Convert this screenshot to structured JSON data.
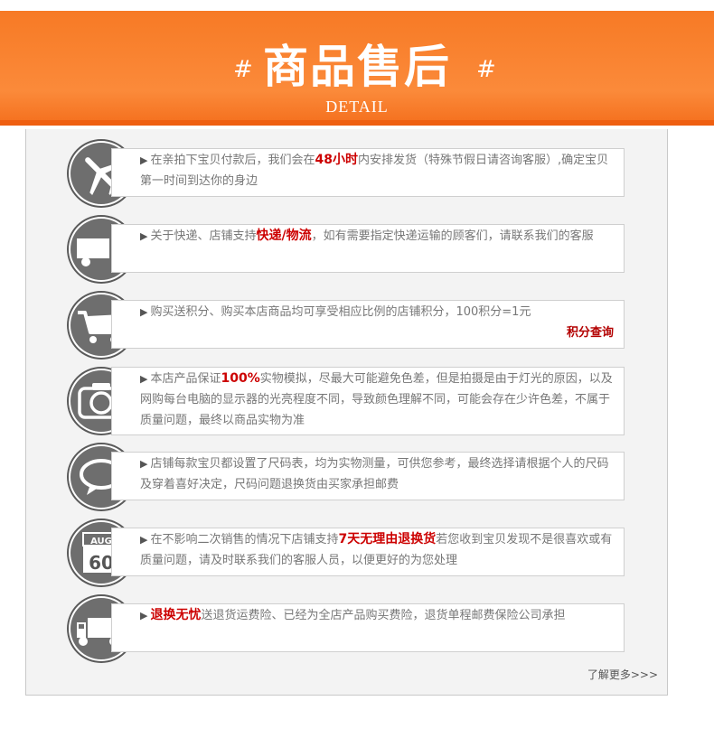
{
  "header": {
    "hash_left": "#",
    "hash_right": "#",
    "title": "商品售后",
    "subtitle": "DETAIL"
  },
  "items": [
    {
      "icon": "airplane-icon",
      "pre": "在亲拍下宝贝付款后，我们会在",
      "highlight": "48小时",
      "post": "内安排发货（特殊节假日请咨询客服）,确定宝贝第一时间到达你的身边"
    },
    {
      "icon": "truck-icon",
      "pre": "关于快递、店铺支持",
      "highlight": "快递/物流",
      "post": "，如有需要指定快递运输的顾客们，请联系我们的客服"
    },
    {
      "icon": "cart-icon",
      "pre": "购买送积分、购买本店商品均可享受相应比例的店铺积分，100积分=1元",
      "highlight": "",
      "post": "",
      "link": "积分查询"
    },
    {
      "icon": "camera-icon",
      "pre": "本店产品保证",
      "highlight": "100%",
      "post": "实物模拟，尽最大可能避免色差，但是拍摄是由于灯光的原因，以及网购每台电脑的显示器的光亮程度不同，导致颜色理解不同，可能会存在少许色差，不属于质量问题，最终以商品实物为准"
    },
    {
      "icon": "speech-bubble-icon",
      "pre": "店铺每款宝贝都设置了尺码表，均为实物测量，可供您参考，最终选择请根据个人的尺码及穿着喜好决定，尺码问题退换货由买家承担邮费",
      "highlight": "",
      "post": ""
    },
    {
      "icon": "calendar-icon",
      "calendar_month": "AUG",
      "calendar_day": "60",
      "pre": "在不影响二次销售的情况下店铺支持",
      "highlight": "7天无理由退换货",
      "post": "若您收到宝贝发现不是很喜欢或有质量问题，请及时联系我们的客服人员，以便更好的为您处理"
    },
    {
      "icon": "delivery-van-icon",
      "pre": "",
      "highlight": "退换无忧",
      "post": "送退货运费险、已经为全店产品购买费险，退货单程邮费保险公司承担"
    }
  ],
  "footer": {
    "more_link": "了解更多>>>"
  },
  "colors": {
    "accent": "#f97a24",
    "highlight": "#cc0000",
    "icon_bg": "#6e6e6e"
  }
}
